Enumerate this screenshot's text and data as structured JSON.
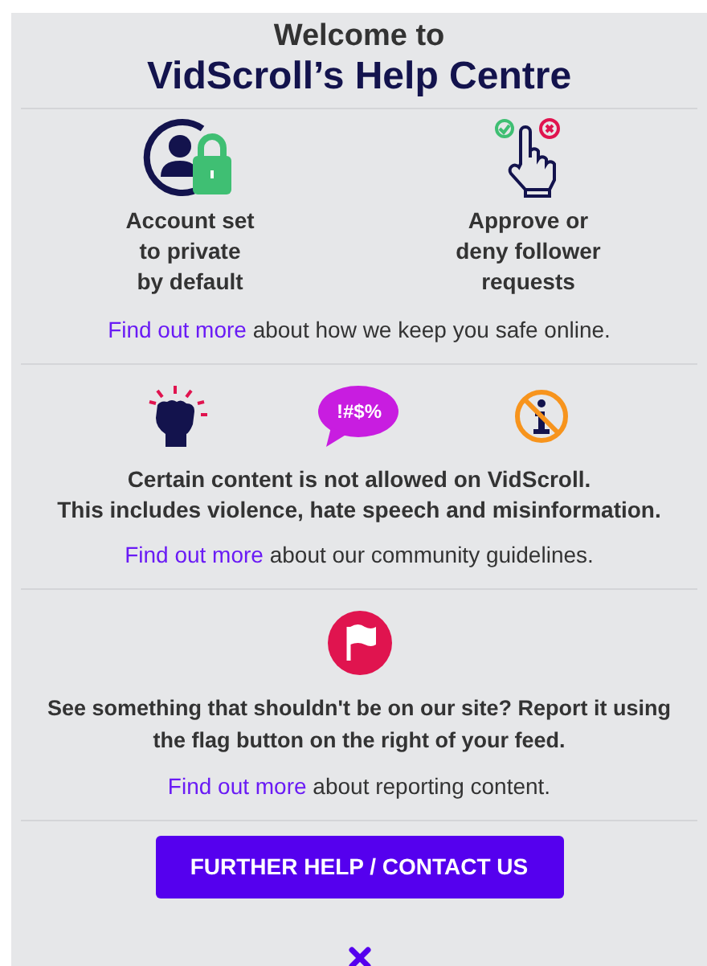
{
  "header": {
    "line1": "Welcome to",
    "line2": "VidScroll’s Help Centre"
  },
  "sections": [
    {
      "kind": "features",
      "features": [
        {
          "kind": "private",
          "text": "Account set\nto private\nby default"
        },
        {
          "kind": "approve",
          "text": "Approve or\ndeny follower\nrequests"
        }
      ],
      "info": {
        "link": "Find out more",
        "text": " about how we keep you safe online."
      }
    },
    {
      "kind": "rules",
      "icons": [
        {
          "kind": "fist"
        },
        {
          "kind": "bubble",
          "label": "!#$%"
        },
        {
          "kind": "noinfo"
        }
      ],
      "body": "Certain content is not allowed on VidScroll.\nThis includes violence, hate speech and misinformation.",
      "info": {
        "link": "Find out more",
        "text": " about our community guidelines."
      }
    },
    {
      "kind": "report",
      "body": "See something that shouldn't be on our site? Report it using\nthe flag button on the right of your feed.",
      "info": {
        "link": "Find out more",
        "text": " about reporting content."
      }
    }
  ],
  "button": "FURTHER HELP / CONTACT US"
}
